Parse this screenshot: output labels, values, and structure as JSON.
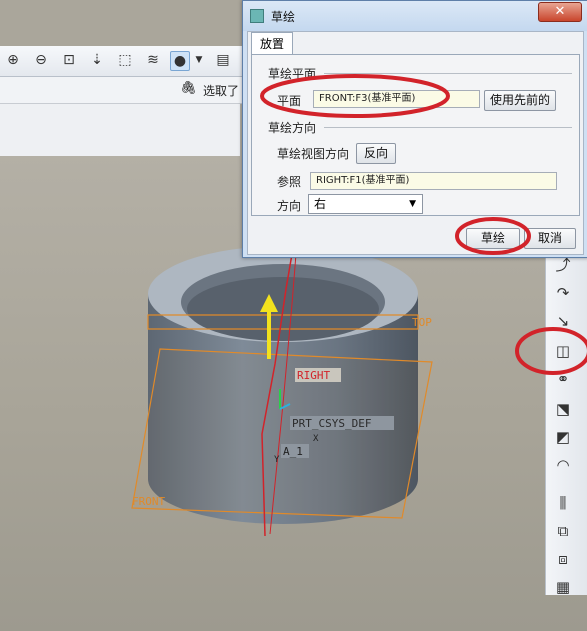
{
  "dialog": {
    "title": "草绘",
    "close": "✕",
    "tab_label": "放置",
    "sketch_plane_group": "草绘平面",
    "plane_label": "平面",
    "plane_value": "FRONT:F3(基准平面)",
    "use_previous_button": "使用先前的",
    "orientation_group": "草绘方向",
    "view_direction_label": "草绘视图方向",
    "flip_button": "反向",
    "reference_label": "参照",
    "reference_value": "RIGHT:F1(基准平面)",
    "direction_label": "方向",
    "direction_value": "右",
    "sketch_button": "草绘",
    "cancel_button": "取消"
  },
  "status": {
    "select_text": "选取了"
  },
  "viewport": {
    "labels": {
      "top": "TOP",
      "right": "RIGHT",
      "front": "FRONT",
      "csys": "PRT_CSYS_DEF",
      "axis": "A_1",
      "axis_x": "X",
      "axis_y": "Y"
    }
  },
  "toolbar": {
    "icons": [
      "zoom-in-icon",
      "zoom-out-icon",
      "refit-icon",
      "orient-icon",
      "saved-views-icon",
      "layers-icon",
      "spin-center-icon",
      "dropdown-icon",
      "save-view-icon"
    ]
  },
  "colors": {
    "highlight_ellipse": "#d2232a",
    "datum_plane": "#e08a2a",
    "model": "#6e7a87"
  }
}
